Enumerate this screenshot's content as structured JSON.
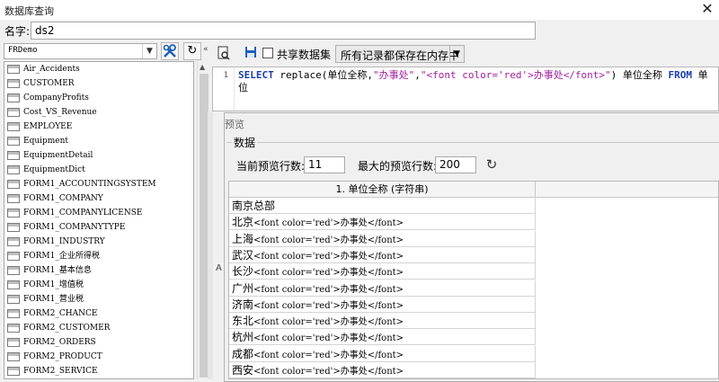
{
  "window": {
    "title": "数据库查询",
    "close": "✕"
  },
  "name_field": {
    "label": "名字:",
    "value": "ds2"
  },
  "datasource": {
    "selected": "FRDemo"
  },
  "tables": [
    "Air_Accidents",
    "CUSTOMER",
    "CompanyProfits",
    "Cost_VS_Revenue",
    "EMPLOYEE",
    "Equipment",
    "EquipmentDetail",
    "EquipmentDict",
    "FORM1_ACCOUNTINGSYSTEM",
    "FORM1_COMPANY",
    "FORM1_COMPANYLICENSE",
    "FORM1_COMPANYTYPE",
    "FORM1_INDUSTRY",
    "FORM1_企业所得税",
    "FORM1_基本信息",
    "FORM1_增值税",
    "FORM1_营业税",
    "FORM2_CHANCE",
    "FORM2_CUSTOMER",
    "FORM2_ORDERS",
    "FORM2_PRODUCT",
    "FORM2_SERVICE"
  ],
  "sql_toolbar": {
    "share_label": "共享数据集",
    "mode_value": "所有记录都保存在内存中"
  },
  "sql": {
    "line_number": "1",
    "parts": [
      {
        "t": "SELECT",
        "c": "kw"
      },
      {
        "t": " replace(单位全称,",
        "c": ""
      },
      {
        "t": "\"办事处\"",
        "c": "str"
      },
      {
        "t": ",",
        "c": ""
      },
      {
        "t": "\"<font color='red'>办事处</font>\"",
        "c": "str"
      },
      {
        "t": ") 单位全称 ",
        "c": ""
      },
      {
        "t": "FROM",
        "c": "kw"
      },
      {
        "t": " 单位",
        "c": ""
      }
    ]
  },
  "preview": {
    "title": "预览",
    "group_label": "数据",
    "rows_label": "当前预览行数:",
    "rows_value": "11",
    "max_label": "最大的预览行数:",
    "max_value": "200",
    "column_header": "1.  单位全称 (字符串)",
    "rows": [
      {
        "city": "南京总部",
        "html": ""
      },
      {
        "city": "北京",
        "html": "<font color='red'>办事处</font>"
      },
      {
        "city": "上海",
        "html": "<font color='red'>办事处</font>"
      },
      {
        "city": "武汉",
        "html": "<font color='red'>办事处</font>"
      },
      {
        "city": "长沙",
        "html": "<font color='red'>办事处</font>"
      },
      {
        "city": "广州",
        "html": "<font color='red'>办事处</font>"
      },
      {
        "city": "济南",
        "html": "<font color='red'>办事处</font>"
      },
      {
        "city": "东北",
        "html": "<font color='red'>办事处</font>"
      },
      {
        "city": "杭州",
        "html": "<font color='red'>办事处</font>"
      },
      {
        "city": "成都",
        "html": "<font color='red'>办事处</font>"
      },
      {
        "city": "西安",
        "html": "<font color='red'>办事处</font>"
      }
    ]
  },
  "colors": {
    "sql_keyword": "#1a3fa8",
    "sql_string": "#a4209f",
    "accent_blue": "#1e5fb8"
  }
}
